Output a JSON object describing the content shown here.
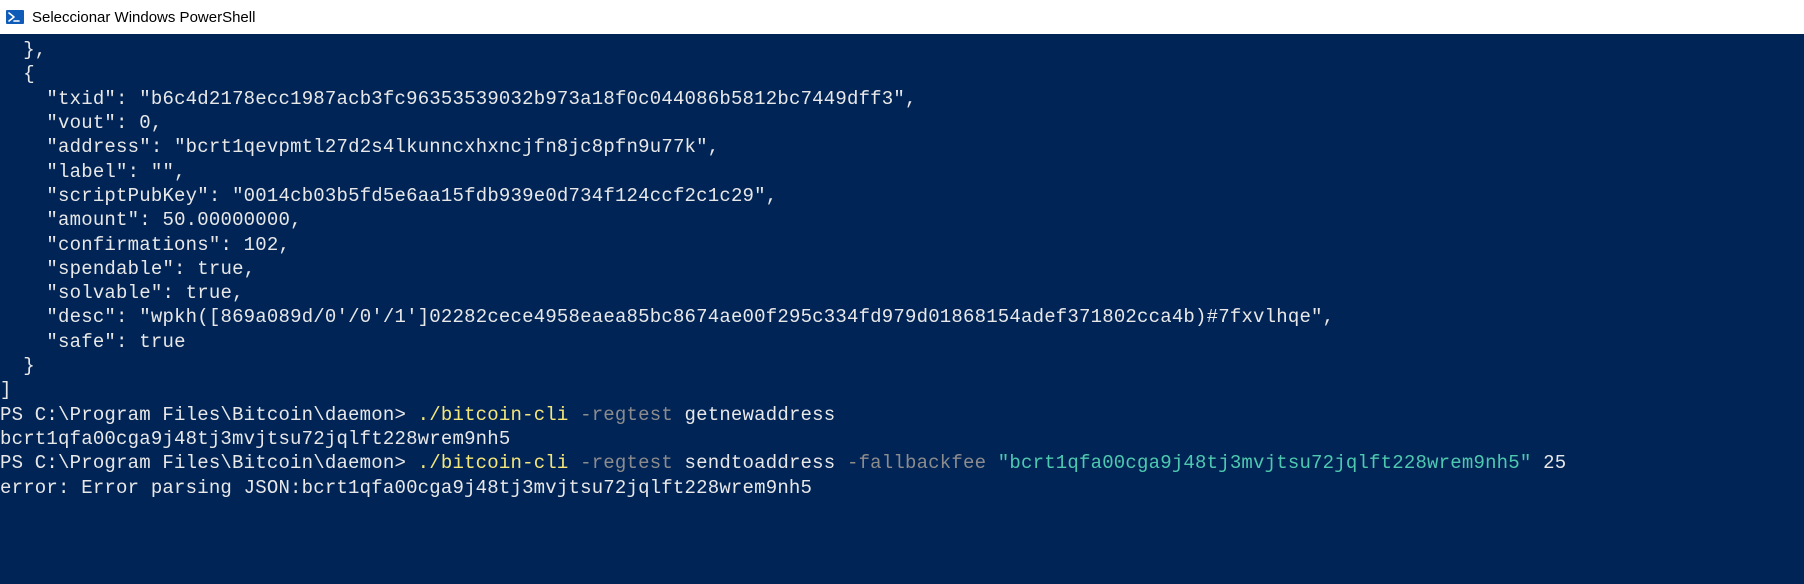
{
  "window": {
    "title": "Seleccionar Windows PowerShell"
  },
  "json_fragment": {
    "close_prev": "  },",
    "open_obj": "  {",
    "close_obj": "  }",
    "close_arr": "]",
    "txid_key": "\"txid\"",
    "txid_val": "\"b6c4d2178ecc1987acb3fc96353539032b973a18f0c044086b5812bc7449dff3\"",
    "vout_key": "\"vout\"",
    "vout_val": "0",
    "address_key": "\"address\"",
    "address_val": "\"bcrt1qevpmtl27d2s4lkunncxhxncjfn8jc8pfn9u77k\"",
    "label_key": "\"label\"",
    "label_val": "\"\"",
    "scriptpk_key": "\"scriptPubKey\"",
    "scriptpk_val": "\"0014cb03b5fd5e6aa15fdb939e0d734f124ccf2c1c29\"",
    "amount_key": "\"amount\"",
    "amount_val": "50.00000000",
    "confirm_key": "\"confirmations\"",
    "confirm_val": "102",
    "spendable_key": "\"spendable\"",
    "spendable_val": "true",
    "solvable_key": "\"solvable\"",
    "solvable_val": "true",
    "desc_key": "\"desc\"",
    "desc_val": "\"wpkh([869a089d/0'/0'/1']02282cece4958eaea85bc8674ae00f295c334fd979d01868154adef371802cca4b)#7fxvlhqe\"",
    "safe_key": "\"safe\"",
    "safe_val": "true"
  },
  "prompt1": {
    "ps": "PS C:\\Program Files\\Bitcoin\\daemon> ",
    "cmd": "./bitcoin-cli",
    "flag1": " -regtest",
    "arg1": " getnewaddress"
  },
  "output1": "bcrt1qfa00cga9j48tj3mvjtsu72jqlft228wrem9nh5",
  "prompt2": {
    "ps": "PS C:\\Program Files\\Bitcoin\\daemon> ",
    "cmd": "./bitcoin-cli",
    "flag1": " -regtest",
    "arg1": " sendtoaddress",
    "flag2": " -fallbackfee",
    "quoted": " \"bcrt1qfa00cga9j48tj3mvjtsu72jqlft228wrem9nh5\"",
    "arg2": " 25"
  },
  "error_line": "error: Error parsing JSON:bcrt1qfa00cga9j48tj3mvjtsu72jqlft228wrem9nh5"
}
